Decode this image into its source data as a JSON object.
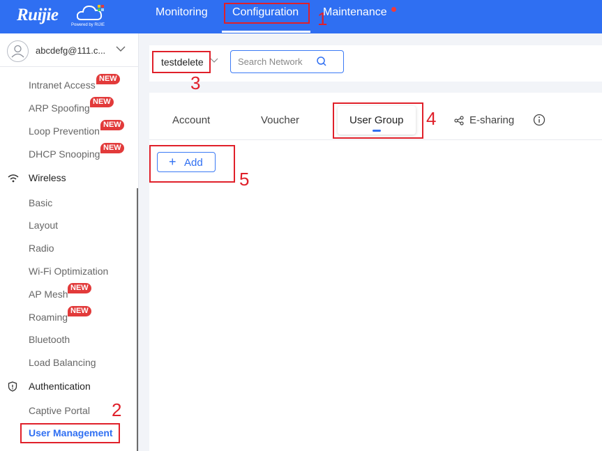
{
  "brand": {
    "name": "Ruijie",
    "powered_by": "Powered by RIJIE"
  },
  "nav": {
    "monitoring": "Monitoring",
    "configuration": "Configuration",
    "maintenance": "Maintenance"
  },
  "user": {
    "email": "abcdefg@111.c..."
  },
  "sidebar": {
    "items": [
      {
        "label": "Intranet Access",
        "badge": "NEW"
      },
      {
        "label": "ARP Spoofing",
        "badge": "NEW"
      },
      {
        "label": "Loop Prevention",
        "badge": "NEW"
      },
      {
        "label": "DHCP Snooping",
        "badge": "NEW"
      }
    ],
    "wireless": {
      "label": "Wireless",
      "items": [
        {
          "label": "Basic"
        },
        {
          "label": "Layout"
        },
        {
          "label": "Radio"
        },
        {
          "label": "Wi-Fi Optimization"
        },
        {
          "label": "AP Mesh",
          "badge": "NEW"
        },
        {
          "label": "Roaming",
          "badge": "NEW"
        },
        {
          "label": "Bluetooth"
        },
        {
          "label": "Load Balancing"
        }
      ]
    },
    "authentication": {
      "label": "Authentication",
      "items": [
        {
          "label": "Captive Portal"
        },
        {
          "label": "User Management"
        }
      ]
    }
  },
  "network": {
    "name": "testdelete"
  },
  "search": {
    "placeholder": "Search Network"
  },
  "tabs": {
    "account": "Account",
    "voucher": "Voucher",
    "user_group": "User Group",
    "esharing": "E-sharing"
  },
  "add_button": {
    "label": "Add"
  },
  "annotations": [
    "1",
    "2",
    "3",
    "4",
    "5"
  ],
  "colors": {
    "brand_blue": "#2f6ff2",
    "badge_red": "#e23a3a",
    "annotation_red": "#e0202a"
  }
}
